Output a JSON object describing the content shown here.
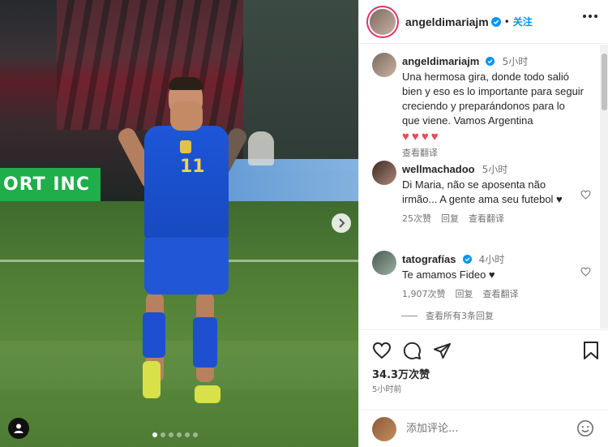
{
  "photo": {
    "board_text": "ORT INC",
    "jersey_number": "11",
    "carousel": {
      "total": 6,
      "active": 1
    }
  },
  "header": {
    "username": "angeldimariajm",
    "follow_label": "关注",
    "separator": "•"
  },
  "caption": {
    "username": "angeldimariajm",
    "time": "5小时",
    "text": "Una hermosa gira, donde todo salió bien y eso es lo importante para seguir creciendo y preparándonos para lo que viene. Vamos Argentina",
    "hearts": "♥♥♥♥",
    "translate": "查看翻译"
  },
  "comments": [
    {
      "username": "wellmachadoo",
      "time": "5小时",
      "text": "Di Maria, não se aposenta não irmão... A gente ama seu futebol ♥",
      "likes": "25次赞",
      "reply": "回复",
      "translate": "查看翻译"
    },
    {
      "username": "tatografías",
      "time": "4小时",
      "text": "Te amamos Fideo ♥",
      "likes": "1,907次赞",
      "reply": "回复",
      "translate": "查看翻译"
    }
  ],
  "view_replies": "查看所有3条回复",
  "likes_total": "34.3万次赞",
  "post_time": "5小时前",
  "add_comment": {
    "placeholder": "添加评论..."
  },
  "colors": {
    "accent": "#0095f6",
    "heart": "#ed4956",
    "verified": "#0095f6"
  }
}
